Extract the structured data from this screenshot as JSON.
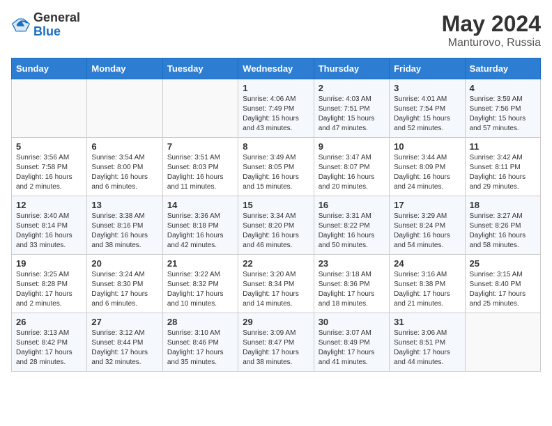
{
  "header": {
    "logo_general": "General",
    "logo_blue": "Blue",
    "month": "May 2024",
    "location": "Manturovo, Russia"
  },
  "days_of_week": [
    "Sunday",
    "Monday",
    "Tuesday",
    "Wednesday",
    "Thursday",
    "Friday",
    "Saturday"
  ],
  "weeks": [
    [
      {
        "day": "",
        "info": ""
      },
      {
        "day": "",
        "info": ""
      },
      {
        "day": "",
        "info": ""
      },
      {
        "day": "1",
        "info": "Sunrise: 4:06 AM\nSunset: 7:49 PM\nDaylight: 15 hours\nand 43 minutes."
      },
      {
        "day": "2",
        "info": "Sunrise: 4:03 AM\nSunset: 7:51 PM\nDaylight: 15 hours\nand 47 minutes."
      },
      {
        "day": "3",
        "info": "Sunrise: 4:01 AM\nSunset: 7:54 PM\nDaylight: 15 hours\nand 52 minutes."
      },
      {
        "day": "4",
        "info": "Sunrise: 3:59 AM\nSunset: 7:56 PM\nDaylight: 15 hours\nand 57 minutes."
      }
    ],
    [
      {
        "day": "5",
        "info": "Sunrise: 3:56 AM\nSunset: 7:58 PM\nDaylight: 16 hours\nand 2 minutes."
      },
      {
        "day": "6",
        "info": "Sunrise: 3:54 AM\nSunset: 8:00 PM\nDaylight: 16 hours\nand 6 minutes."
      },
      {
        "day": "7",
        "info": "Sunrise: 3:51 AM\nSunset: 8:03 PM\nDaylight: 16 hours\nand 11 minutes."
      },
      {
        "day": "8",
        "info": "Sunrise: 3:49 AM\nSunset: 8:05 PM\nDaylight: 16 hours\nand 15 minutes."
      },
      {
        "day": "9",
        "info": "Sunrise: 3:47 AM\nSunset: 8:07 PM\nDaylight: 16 hours\nand 20 minutes."
      },
      {
        "day": "10",
        "info": "Sunrise: 3:44 AM\nSunset: 8:09 PM\nDaylight: 16 hours\nand 24 minutes."
      },
      {
        "day": "11",
        "info": "Sunrise: 3:42 AM\nSunset: 8:11 PM\nDaylight: 16 hours\nand 29 minutes."
      }
    ],
    [
      {
        "day": "12",
        "info": "Sunrise: 3:40 AM\nSunset: 8:14 PM\nDaylight: 16 hours\nand 33 minutes."
      },
      {
        "day": "13",
        "info": "Sunrise: 3:38 AM\nSunset: 8:16 PM\nDaylight: 16 hours\nand 38 minutes."
      },
      {
        "day": "14",
        "info": "Sunrise: 3:36 AM\nSunset: 8:18 PM\nDaylight: 16 hours\nand 42 minutes."
      },
      {
        "day": "15",
        "info": "Sunrise: 3:34 AM\nSunset: 8:20 PM\nDaylight: 16 hours\nand 46 minutes."
      },
      {
        "day": "16",
        "info": "Sunrise: 3:31 AM\nSunset: 8:22 PM\nDaylight: 16 hours\nand 50 minutes."
      },
      {
        "day": "17",
        "info": "Sunrise: 3:29 AM\nSunset: 8:24 PM\nDaylight: 16 hours\nand 54 minutes."
      },
      {
        "day": "18",
        "info": "Sunrise: 3:27 AM\nSunset: 8:26 PM\nDaylight: 16 hours\nand 58 minutes."
      }
    ],
    [
      {
        "day": "19",
        "info": "Sunrise: 3:25 AM\nSunset: 8:28 PM\nDaylight: 17 hours\nand 2 minutes."
      },
      {
        "day": "20",
        "info": "Sunrise: 3:24 AM\nSunset: 8:30 PM\nDaylight: 17 hours\nand 6 minutes."
      },
      {
        "day": "21",
        "info": "Sunrise: 3:22 AM\nSunset: 8:32 PM\nDaylight: 17 hours\nand 10 minutes."
      },
      {
        "day": "22",
        "info": "Sunrise: 3:20 AM\nSunset: 8:34 PM\nDaylight: 17 hours\nand 14 minutes."
      },
      {
        "day": "23",
        "info": "Sunrise: 3:18 AM\nSunset: 8:36 PM\nDaylight: 17 hours\nand 18 minutes."
      },
      {
        "day": "24",
        "info": "Sunrise: 3:16 AM\nSunset: 8:38 PM\nDaylight: 17 hours\nand 21 minutes."
      },
      {
        "day": "25",
        "info": "Sunrise: 3:15 AM\nSunset: 8:40 PM\nDaylight: 17 hours\nand 25 minutes."
      }
    ],
    [
      {
        "day": "26",
        "info": "Sunrise: 3:13 AM\nSunset: 8:42 PM\nDaylight: 17 hours\nand 28 minutes."
      },
      {
        "day": "27",
        "info": "Sunrise: 3:12 AM\nSunset: 8:44 PM\nDaylight: 17 hours\nand 32 minutes."
      },
      {
        "day": "28",
        "info": "Sunrise: 3:10 AM\nSunset: 8:46 PM\nDaylight: 17 hours\nand 35 minutes."
      },
      {
        "day": "29",
        "info": "Sunrise: 3:09 AM\nSunset: 8:47 PM\nDaylight: 17 hours\nand 38 minutes."
      },
      {
        "day": "30",
        "info": "Sunrise: 3:07 AM\nSunset: 8:49 PM\nDaylight: 17 hours\nand 41 minutes."
      },
      {
        "day": "31",
        "info": "Sunrise: 3:06 AM\nSunset: 8:51 PM\nDaylight: 17 hours\nand 44 minutes."
      },
      {
        "day": "",
        "info": ""
      }
    ]
  ]
}
